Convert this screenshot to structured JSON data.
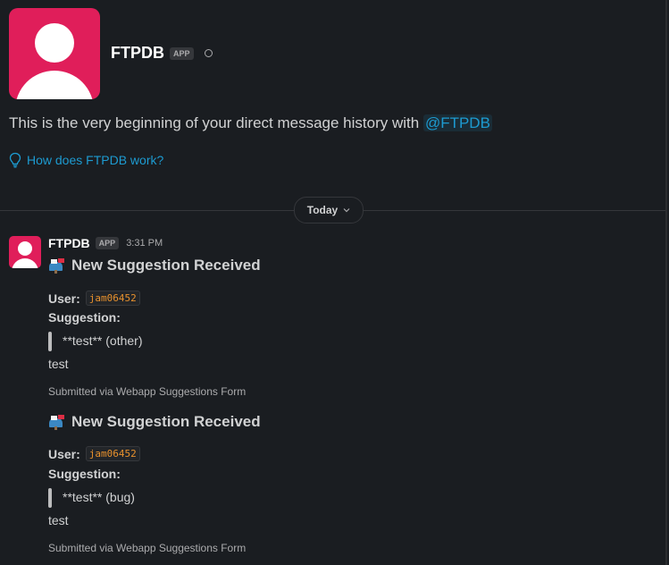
{
  "intro": {
    "name": "FTPDB",
    "app_badge": "APP",
    "history_text": "This is the very beginning of your direct message history with ",
    "mention": "@FTPDB",
    "help_link": "How does FTPDB work?"
  },
  "divider": {
    "label": "Today"
  },
  "message": {
    "sender": "FTPDB",
    "app_badge": "APP",
    "time": "3:31 PM",
    "suggestions": [
      {
        "title": "New Suggestion Received",
        "user_label": "User:",
        "user_value": "jam06452",
        "suggestion_label": "Suggestion:",
        "quote": "**test** (other)",
        "body": "test",
        "footer": "Submitted via Webapp Suggestions Form"
      },
      {
        "title": "New Suggestion Received",
        "user_label": "User:",
        "user_value": "jam06452",
        "suggestion_label": "Suggestion:",
        "quote": "**test** (bug)",
        "body": "test",
        "footer": "Submitted via Webapp Suggestions Form"
      }
    ]
  },
  "colors": {
    "background": "#1a1d21",
    "avatar": "#e01e5a",
    "link": "#1d9bd1",
    "code": "#e8912d"
  },
  "icons": {
    "avatar": "user-avatar-icon",
    "help": "lightbulb-icon",
    "day": "chevron-down-icon",
    "title": "mailbox-icon"
  }
}
